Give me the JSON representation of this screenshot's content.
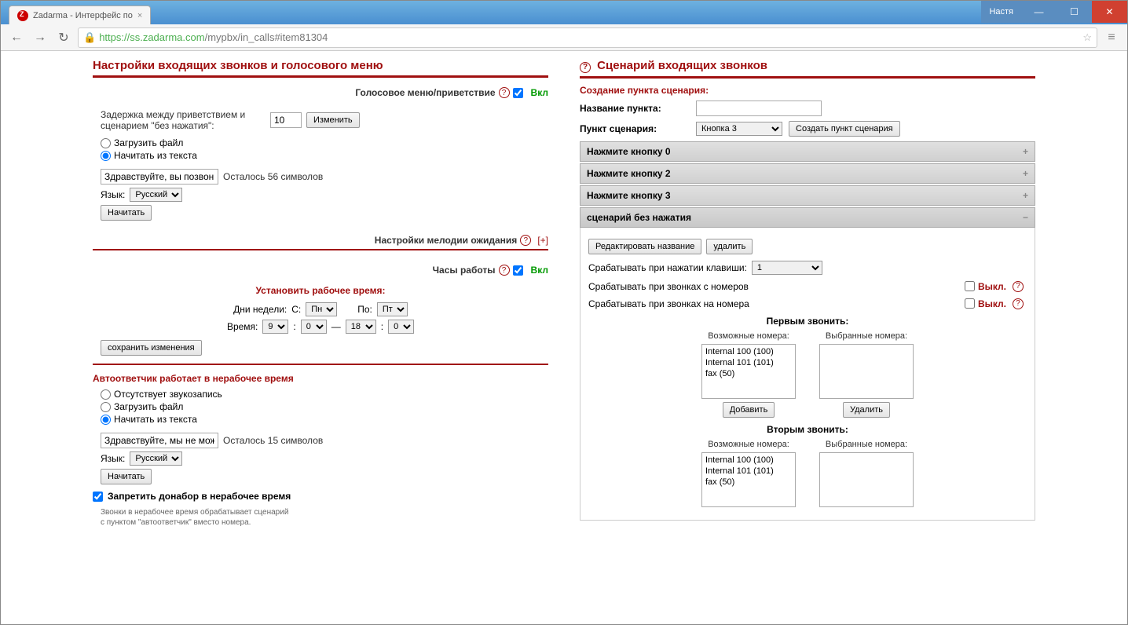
{
  "browser": {
    "tab_title": "Zadarma - Интерфейс по",
    "user": "Настя",
    "url_host": "https://ss.zadarma.com",
    "url_path": "/mypbx/in_calls#item81304"
  },
  "left": {
    "title": "Настройки входящих звонков и голосового меню",
    "voice_menu": {
      "label": "Голосовое меню/приветствие",
      "state": "Вкл",
      "delay_label": "Задержка между приветствием и сценарием \"без нажатия\":",
      "delay_value": "10",
      "change_btn": "Изменить",
      "radio_upload": "Загрузить файл",
      "radio_text": "Начитать из текста",
      "greeting_value": "Здравствуйте, вы позвон",
      "chars_left": "Осталось 56 символов",
      "lang_label": "Язык:",
      "lang_value": "Русский",
      "speak_btn": "Начитать"
    },
    "hold_music": {
      "label": "Настройки мелодии ожидания",
      "expand": "[+]"
    },
    "hours": {
      "label": "Часы работы",
      "state": "Вкл",
      "set_label": "Установить рабочее время:",
      "days_label": "Дни недели:",
      "from_label": "С:",
      "from_day": "Пн",
      "to_label": "По:",
      "to_day": "Пт",
      "time_label": "Время:",
      "h1": "9",
      "m1": "0",
      "h2": "18",
      "m2": "0",
      "save_btn": "сохранить изменения"
    },
    "voicemail": {
      "title": "Автоответчик работает в нерабочее время",
      "radio_none": "Отсутствует звукозапись",
      "radio_upload": "Загрузить файл",
      "radio_text": "Начитать из текста",
      "text_value": "Здравствуйте, мы не мож",
      "chars_left": "Осталось 15 символов",
      "lang_label": "Язык:",
      "lang_value": "Русский",
      "speak_btn": "Начитать",
      "forbid_label": "Запретить донабор в нерабочее время",
      "note1": "Звонки в нерабочее время обрабатывает сценарий",
      "note2": "с пунктом \"автоответчик\" вместо номера."
    }
  },
  "right": {
    "title": "Сценарий входящих звонков",
    "create_label": "Создание пункта сценария:",
    "name_label": "Название пункта:",
    "point_label": "Пункт сценария:",
    "point_value": "Кнопка 3",
    "create_btn": "Создать пункт сценария",
    "acc0": "Нажмите кнопку 0",
    "acc2": "Нажмите кнопку 2",
    "acc3": "Нажмите кнопку 3",
    "acc_open": "сценарий без нажатия",
    "edit_name_btn": "Редактировать название",
    "delete_btn": "удалить",
    "trigger_key_label": "Срабатывать при нажатии клавиши:",
    "trigger_key_value": "1",
    "trigger_from_label": "Срабатывать при звонках с номеров",
    "trigger_to_label": "Срабатывать при звонках на номера",
    "off_label": "Выкл.",
    "first_call": "Первым звонить:",
    "second_call": "Вторым звонить:",
    "avail_label": "Возможные номера:",
    "sel_label": "Выбранные номера:",
    "add_btn": "Добавить",
    "del_btn": "Удалить",
    "numbers": [
      "Internal 100 (100)",
      "Internal 101 (101)",
      "fax (50)"
    ]
  }
}
